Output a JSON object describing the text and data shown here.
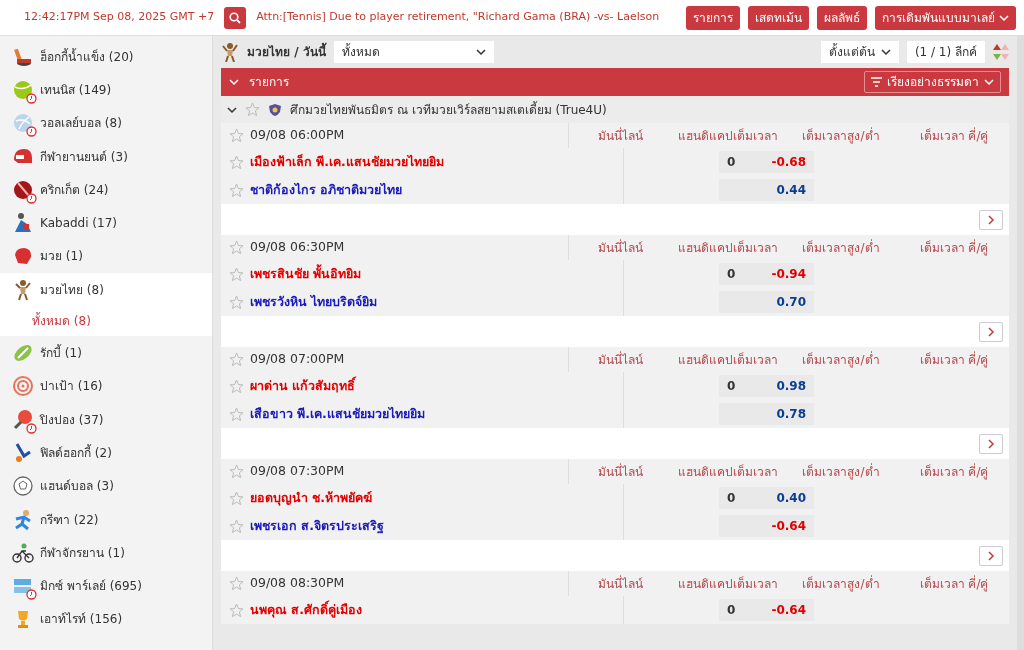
{
  "top_bar": {
    "clock": "12:42:17PM Sep 08, 2025 GMT +7",
    "ticker": "Attn:[Tennis] Due to player retirement, \"Richard Gama (BRA) -vs- Laelson",
    "buttons": [
      {
        "label": "รายการ",
        "dropdown": false
      },
      {
        "label": "เสดทเม้น",
        "dropdown": false
      },
      {
        "label": "ผลลัพธ์",
        "dropdown": false
      },
      {
        "label": "การเดิมพันแบบมาเลย์",
        "dropdown": true
      }
    ]
  },
  "sidebar": {
    "items": [
      {
        "label": "ฮ็อกกี้น้ำแข็ง (20)",
        "live": false,
        "selected": false
      },
      {
        "label": "เทนนิส (149)",
        "live": true,
        "selected": false
      },
      {
        "label": "วอลเลย์บอล (8)",
        "live": true,
        "selected": false
      },
      {
        "label": "กีฬายานยนต์ (3)",
        "live": false,
        "selected": false
      },
      {
        "label": "คริกเก็ต (24)",
        "live": true,
        "selected": false
      },
      {
        "label": "Kabaddi (17)",
        "live": false,
        "selected": false
      },
      {
        "label": "มวย (1)",
        "live": false,
        "selected": false
      },
      {
        "label": "มวยไทย (8)",
        "live": false,
        "selected": true,
        "children": [
          {
            "label": "ทั้งหมด (8)",
            "selected": true
          }
        ]
      },
      {
        "label": "รักบี้ (1)",
        "live": false,
        "selected": false
      },
      {
        "label": "ปาเป้า (16)",
        "live": false,
        "selected": false
      },
      {
        "label": "ปิงปอง (37)",
        "live": true,
        "selected": false
      },
      {
        "label": "ฟิลด์ฮอกกี้ (2)",
        "live": false,
        "selected": false
      },
      {
        "label": "แฮนด์บอล (3)",
        "live": false,
        "selected": false
      },
      {
        "label": "กรีฑา (22)",
        "live": false,
        "selected": false
      },
      {
        "label": "กีฬาจักรยาน (1)",
        "live": false,
        "selected": false
      },
      {
        "label": "มิกซ์ พาร์เลย์ (695)",
        "live": true,
        "selected": false
      },
      {
        "label": "เอาท์ไรท์ (156)",
        "live": false,
        "selected": false
      }
    ]
  },
  "header": {
    "title": "มวยไทย / วันนี้",
    "filter": "ทั้งหมด",
    "sort_start": "ตั้งแต่ต้น",
    "pages": "(1 / 1) ลีกค์"
  },
  "banner": {
    "title": "รายการ",
    "sort": "เรียงอย่างธรรมดา",
    "expanded": true
  },
  "league": {
    "name": "ศึกมวยไทยพันธมิตร ณ เวทีมวยเวิร์ลสยามสเตเดี้ยม (True4U)",
    "expanded": true
  },
  "matches": [
    {
      "time": "09/08 06:00PM",
      "columns": [
        "มันนี่ไลน์",
        "แฮนดิแคปเต็มเวลา",
        "เต็มเวลาสูง/ต่ำ",
        "เต็มเวลา คี่/คู่"
      ],
      "more_button": true,
      "rows": [
        {
          "team": "เมืองฟ้าเล็ก พี.เค.แสนชัยมวยไทยยิม",
          "line": "0",
          "odds": "-0.68",
          "color": "#e00000"
        },
        {
          "team": "ชาติก้องไกร อภิชาติมวยไทย",
          "odds": "0.44",
          "color": "#0b3d91"
        }
      ]
    },
    {
      "time": "09/08 06:30PM",
      "columns": [
        "มันนี่ไลน์",
        "แฮนดิแคปเต็มเวลา",
        "เต็มเวลาสูง/ต่ำ",
        "เต็มเวลา คี่/คู่"
      ],
      "more_button": true,
      "rows": [
        {
          "team": "เพชรสินชัย พั้นอิทยิม",
          "line": "0",
          "odds": "-0.94",
          "color": "#e00000"
        },
        {
          "team": "เพชรวังหิน ไทยบริดจ์ยิม",
          "odds": "0.70",
          "color": "#0b3d91"
        }
      ]
    },
    {
      "time": "09/08 07:00PM",
      "columns": [
        "มันนี่ไลน์",
        "แฮนดิแคปเต็มเวลา",
        "เต็มเวลาสูง/ต่ำ",
        "เต็มเวลา คี่/คู่"
      ],
      "more_button": true,
      "rows": [
        {
          "team": "ผาด่าน แก้วสัมฤทธิ์",
          "line": "0",
          "odds": "0.98",
          "color": "#0b3d91"
        },
        {
          "team": "เสือขาว พี.เค.แสนชัยมวยไทยยิม",
          "odds": "0.78",
          "color": "#0b3d91"
        }
      ]
    },
    {
      "time": "09/08 07:30PM",
      "columns": [
        "มันนี่ไลน์",
        "แฮนดิแคปเต็มเวลา",
        "เต็มเวลาสูง/ต่ำ",
        "เต็มเวลา คี่/คู่"
      ],
      "more_button": true,
      "rows": [
        {
          "team": "ยอดบุญนำ ช.ห้าพยัคฆ์",
          "line": "0",
          "odds": "0.40",
          "color": "#0b3d91"
        },
        {
          "team": "เพชรเอก ส.จิตรประเสริฐ",
          "odds": "-0.64",
          "color": "#e00000"
        }
      ]
    },
    {
      "time": "09/08 08:30PM",
      "columns": [
        "มันนี่ไลน์",
        "แฮนดิแคปเต็มเวลา",
        "เต็มเวลาสูง/ต่ำ",
        "เต็มเวลา คี่/คู่"
      ],
      "more_button": false,
      "rows": [
        {
          "team": "นพคุณ ส.ศักดิ์คู่เมือง",
          "line": "0",
          "odds": "-0.64",
          "color": "#e00000"
        }
      ]
    }
  ]
}
